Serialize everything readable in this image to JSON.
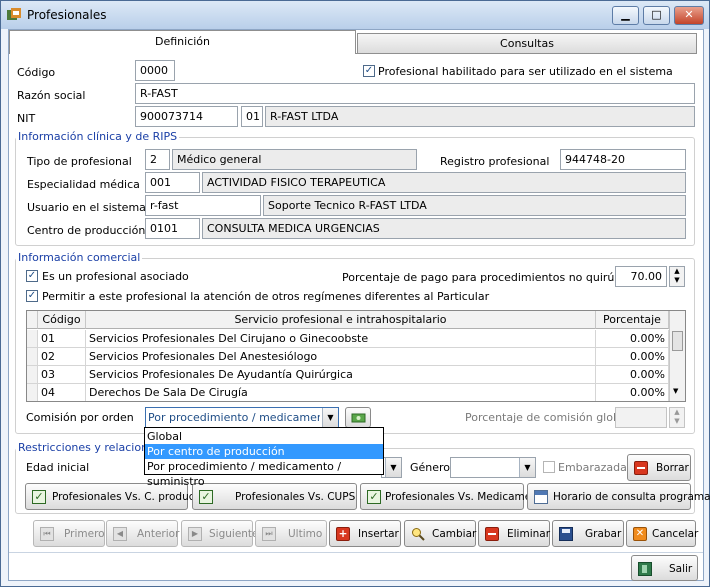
{
  "window": {
    "title": "Profesionales",
    "minimize": "▁",
    "maximize": "□",
    "close": "✕"
  },
  "tabs": [
    {
      "label": "Definición"
    },
    {
      "label": "Consultas"
    }
  ],
  "general": {
    "codigo_label": "Código",
    "codigo_value": "0000",
    "habilitado_label": "Profesional habilitado para ser utilizado en el sistema",
    "razon_label": "Razón social",
    "razon_value": "R-FAST",
    "nit_label": "NIT",
    "nit_value": "900073714",
    "nit_dv": "01",
    "nit_name": "R-FAST LTDA"
  },
  "clinica": {
    "title": "Información clínica y de RIPS",
    "tipo_label": "Tipo de profesional",
    "tipo_code": "2",
    "tipo_name": "Médico general",
    "registro_label": "Registro profesional",
    "registro_value": "944748-20",
    "especialidad_label": "Especialidad médica",
    "especialidad_code": "001",
    "especialidad_name": "ACTIVIDAD FISICO TERAPEUTICA",
    "usuario_label": "Usuario en el sistema",
    "usuario_code": "r-fast",
    "usuario_name": "Soporte Tecnico R-FAST LTDA",
    "centro_label": "Centro de producción",
    "centro_code": "0101",
    "centro_name": "CONSULTA MEDICA URGENCIAS"
  },
  "comercial": {
    "title": "Información comercial",
    "asociado_label": "Es un profesional asociado",
    "porcentaje_label": "Porcentaje de pago para procedimientos no quirúrgicos",
    "porcentaje_value": "70.00",
    "permitir_label": "Permitir a este profesional la atención de otros regímenes diferentes al Particular",
    "grid": {
      "headers": [
        "Código",
        "Servicio profesional e intrahospitalario",
        "Porcentaje"
      ],
      "rows": [
        {
          "code": "01",
          "name": "Servicios Profesionales Del Cirujano o Ginecoobste",
          "pct": "0.00%"
        },
        {
          "code": "02",
          "name": "Servicios Profesionales Del Anestesiólogo",
          "pct": "0.00%"
        },
        {
          "code": "03",
          "name": "Servicios Profesionales De Ayudantía Quirúrgica",
          "pct": "0.00%"
        },
        {
          "code": "04",
          "name": "Derechos De Sala De Cirugía",
          "pct": "0.00%"
        }
      ]
    },
    "comision_label": "Comisión por orden",
    "comision_value": "Por procedimiento / medicamento / s",
    "comision_global_label": "Porcentaje de comisión global",
    "options": [
      "Global",
      "Por centro de producción",
      "Por procedimiento / medicamento / suministro"
    ]
  },
  "restricciones": {
    "title": "Restricciones y relaciones",
    "edad_label": "Edad inicial",
    "genero_label": "Género",
    "embarazada_label": "Embarazada",
    "borrar_label": "Borrar",
    "rel_buttons": [
      "Profesionales Vs. C. producción",
      "Profesionales Vs. CUPS",
      "Profesionales Vs. Medicamentos",
      "Horario de consulta programada"
    ]
  },
  "navigation": [
    "Primero",
    "Anterior",
    "Siguiente",
    "Ultimo"
  ],
  "actions": [
    "Insertar",
    "Cambiar",
    "Eliminar",
    "Grabar",
    "Cancelar"
  ],
  "salir_label": "Salir"
}
